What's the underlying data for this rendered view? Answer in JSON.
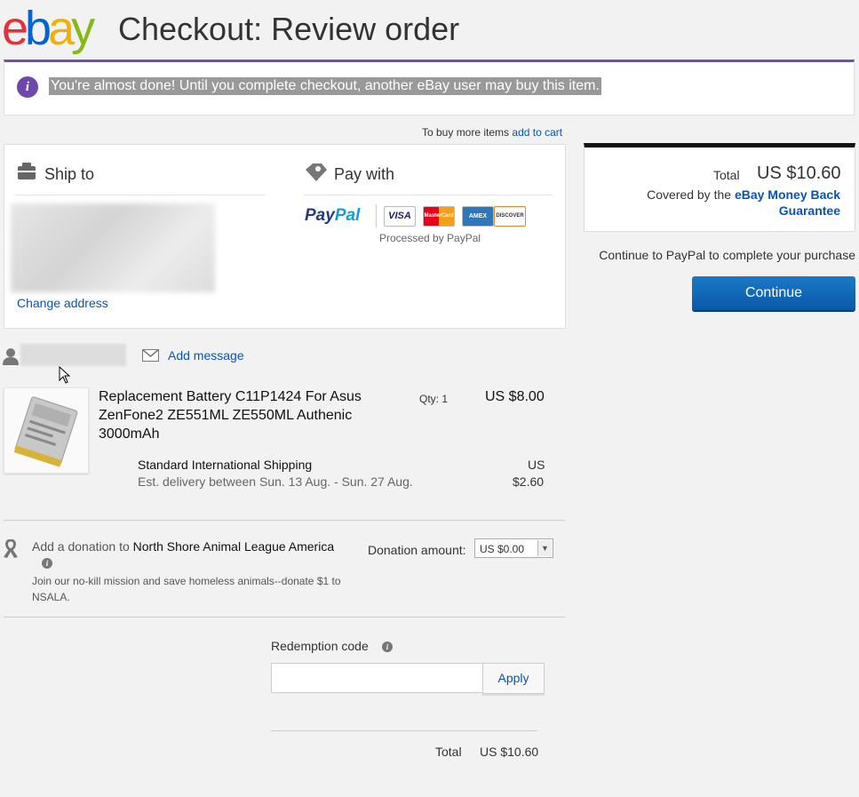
{
  "header": {
    "logo": [
      "e",
      "b",
      "a",
      "y"
    ],
    "logo_colors": [
      "#e53238",
      "#0064d2",
      "#f5af02",
      "#86b817"
    ],
    "title": "Checkout: Review order"
  },
  "notice": {
    "icon": "info-icon",
    "text": "You're almost done! Until you complete checkout, another eBay user may buy this item."
  },
  "buy_more": {
    "prefix": "To buy more items",
    "link": "add to cart"
  },
  "ship_to": {
    "title": "Ship to",
    "change_link": "Change address"
  },
  "pay_with": {
    "title": "Pay with",
    "paypal_a": "Pay",
    "paypal_b": "Pal",
    "cards": [
      "VISA",
      "MasterCard",
      "AMEX",
      "DISCOVER"
    ],
    "processed": "Processed by PayPal"
  },
  "seller": {
    "add_message": "Add message"
  },
  "item": {
    "title": "Replacement Battery C11P1424 For Asus ZenFone2 ZE551ML ZE550ML Authenic 3000mAh",
    "qty": "Qty: 1",
    "price": "US $8.00",
    "shipping_name": "Standard International Shipping",
    "shipping_est": "Est. delivery between Sun. 13 Aug. - Sun. 27 Aug.",
    "shipping_cost_line1": "US",
    "shipping_cost_line2": "$2.60"
  },
  "donation": {
    "prefix": "Add a donation to",
    "org": "North Shore Animal League America",
    "description": "Join our no-kill mission and save homeless animals--donate $1 to NSALA.",
    "amount_label": "Donation amount:",
    "amount_value": "US $0.00"
  },
  "redemption": {
    "label": "Redemption code",
    "apply": "Apply",
    "input_value": ""
  },
  "order_total": {
    "label": "Total",
    "value": "US $10.60"
  },
  "summary": {
    "total_label": "Total",
    "total_value": "US $10.60",
    "covered_prefix": "Covered by the",
    "covered_link": "eBay Money Back Guarantee",
    "continue_text": "Continue to PayPal to complete your purchase",
    "continue_button": "Continue"
  }
}
